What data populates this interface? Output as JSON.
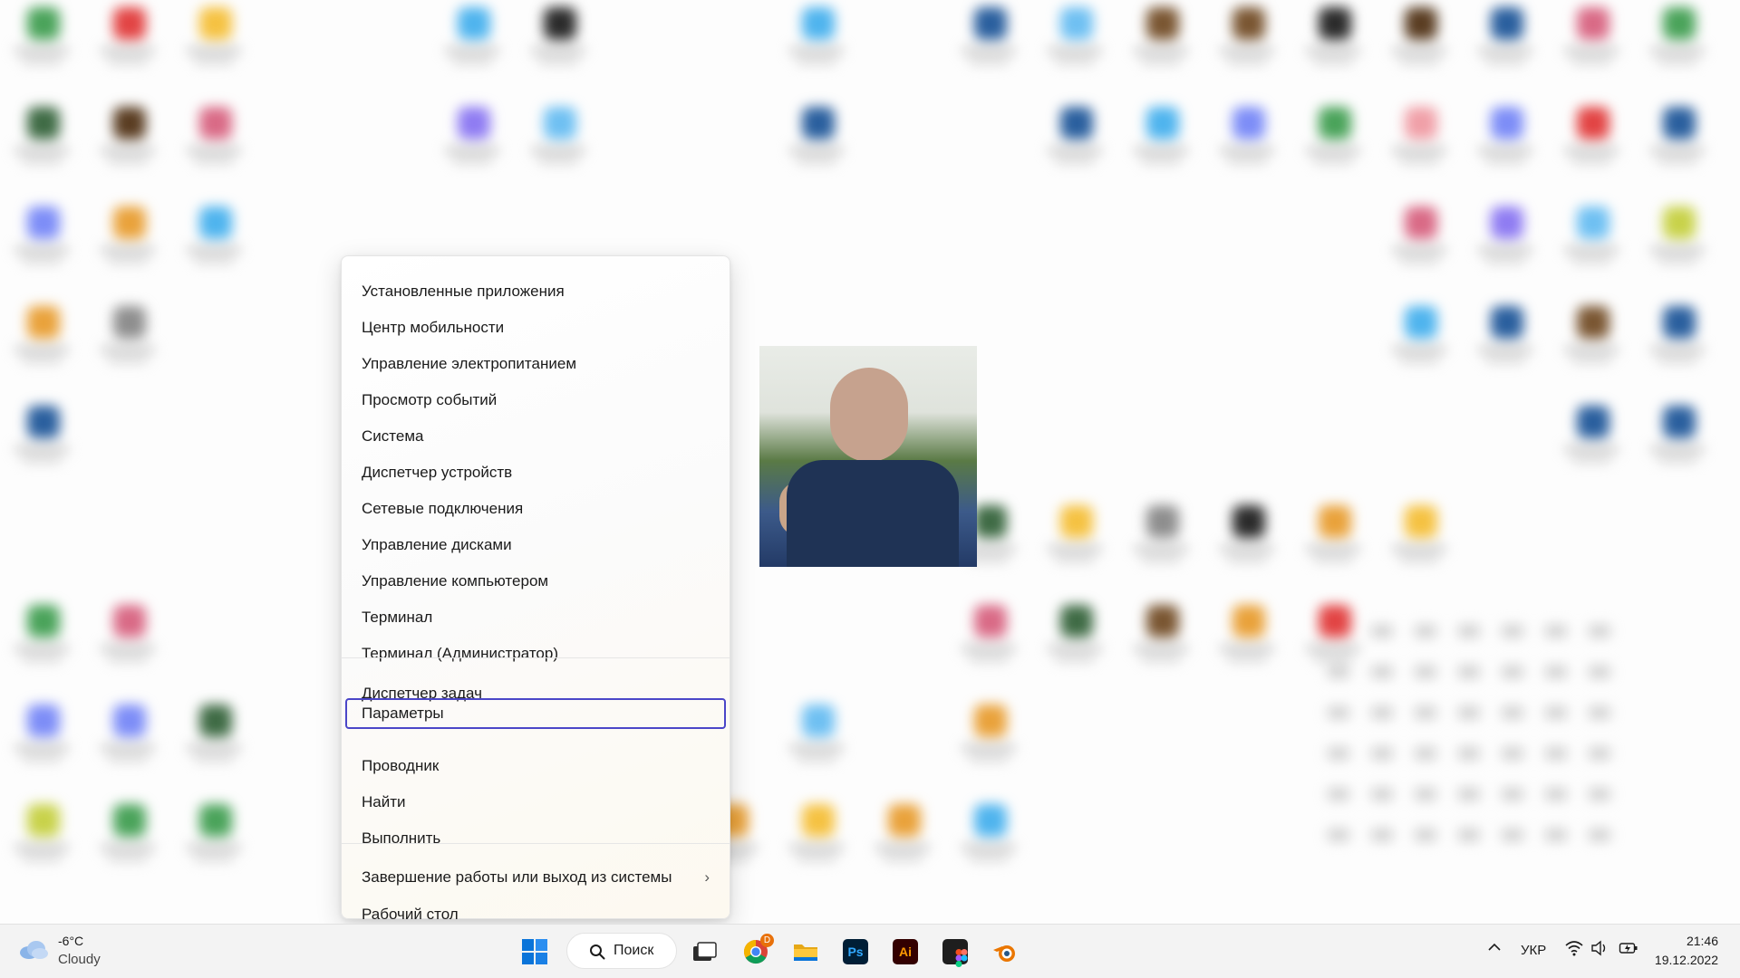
{
  "context_menu": {
    "items": [
      {
        "label": "Установленные приложения"
      },
      {
        "label": "Центр мобильности"
      },
      {
        "label": "Управление электропитанием"
      },
      {
        "label": "Просмотр событий"
      },
      {
        "label": "Система"
      },
      {
        "label": "Диспетчер устройств"
      },
      {
        "label": "Сетевые подключения"
      },
      {
        "label": "Управление дисками"
      },
      {
        "label": "Управление компьютером"
      },
      {
        "label": "Терминал"
      },
      {
        "label": "Терминал (Администратор)"
      },
      {
        "label": "Диспетчер задач"
      },
      {
        "label": "Параметры",
        "focused": true
      },
      {
        "label": "Проводник"
      },
      {
        "label": "Найти"
      },
      {
        "label": "Выполнить"
      },
      {
        "label": "Завершение работы или выход из системы",
        "submenu": true
      },
      {
        "label": "Рабочий стол"
      }
    ]
  },
  "taskbar": {
    "weather": {
      "temperature": "-6°C",
      "condition": "Cloudy",
      "icon": "cloud-icon"
    },
    "search": {
      "label": "Поиск",
      "icon": "search-icon"
    },
    "apps": [
      {
        "name": "start-button",
        "icon": "windows-logo-icon"
      },
      {
        "name": "task-view-button",
        "icon": "task-view-icon"
      },
      {
        "name": "chrome-button",
        "icon": "chrome-icon",
        "badge": "D"
      },
      {
        "name": "file-explorer-button",
        "icon": "folder-icon"
      },
      {
        "name": "photoshop-button",
        "icon": "photoshop-icon",
        "text": "Ps"
      },
      {
        "name": "illustrator-button",
        "icon": "illustrator-icon",
        "text": "Ai"
      },
      {
        "name": "figma-button",
        "icon": "figma-icon"
      },
      {
        "name": "blender-button",
        "icon": "blender-icon"
      }
    ],
    "tray": {
      "language": "УКР",
      "time": "21:46",
      "date": "19.12.2022"
    }
  },
  "colors": {
    "focus_outline": "#4b46c8",
    "taskbar_bg": "#f3f3f3",
    "windows_blue": "#0a74d9",
    "photoshop_bg": "#001e36",
    "photoshop_fg": "#31a8ff",
    "illustrator_bg": "#330000",
    "illustrator_fg": "#ff9a00"
  }
}
